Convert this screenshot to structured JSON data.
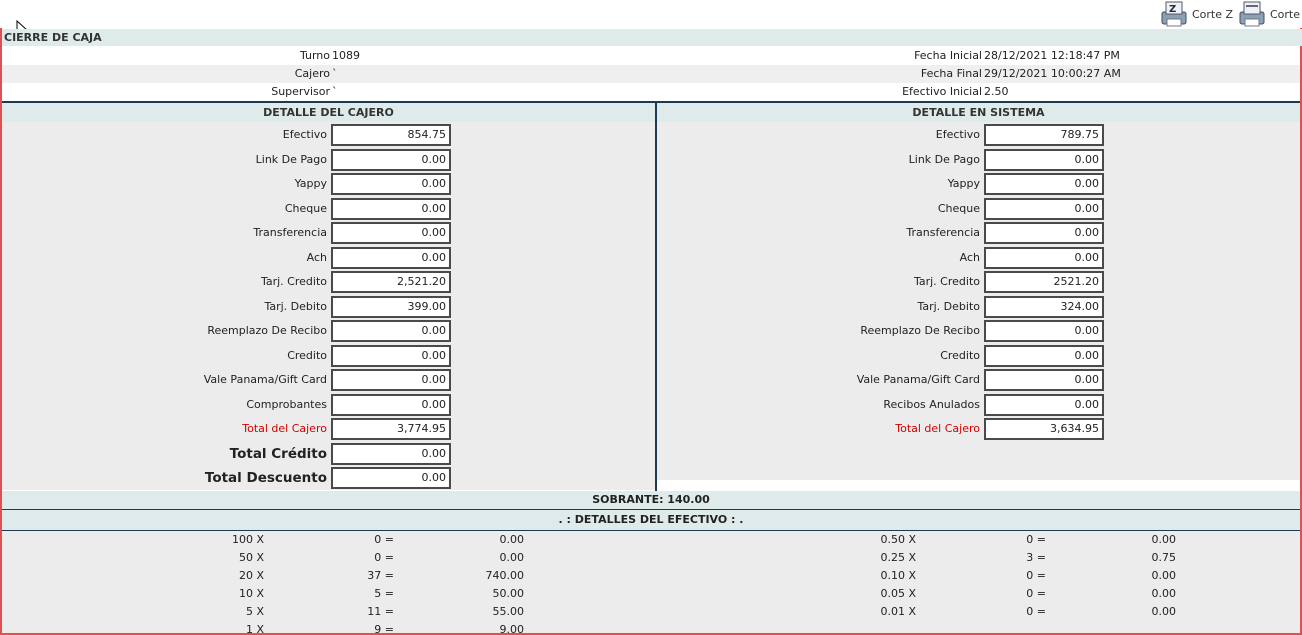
{
  "toolbar": {
    "corte_z_label": "Corte Z",
    "corte_label": "Corte"
  },
  "header": {
    "title": "CIERRE DE CAJA",
    "turno_label": "Turno",
    "turno_value": "1089",
    "cajero_label": "Cajero",
    "cajero_value": "`",
    "supervisor_label": "Supervisor",
    "supervisor_value": "`",
    "fecha_inicial_label": "Fecha Inicial",
    "fecha_inicial_value": "28/12/2021 12:18:47 PM",
    "fecha_final_label": "Fecha Final",
    "fecha_final_value": "29/12/2021 10:00:27 AM",
    "efectivo_inicial_label": "Efectivo Inicial",
    "efectivo_inicial_value": "2.50"
  },
  "cajero": {
    "title": "DETALLE DEL CAJERO",
    "rows": [
      {
        "label": "Efectivo",
        "value": "854.75"
      },
      {
        "label": "Link De Pago",
        "value": "0.00"
      },
      {
        "label": "Yappy",
        "value": "0.00"
      },
      {
        "label": "Cheque",
        "value": "0.00"
      },
      {
        "label": "Transferencia",
        "value": "0.00"
      },
      {
        "label": "Ach",
        "value": "0.00"
      },
      {
        "label": "Tarj. Credito",
        "value": "2,521.20"
      },
      {
        "label": "Tarj. Debito",
        "value": "399.00"
      },
      {
        "label": "Reemplazo De Recibo",
        "value": "0.00"
      },
      {
        "label": "Credito",
        "value": "0.00"
      },
      {
        "label": "Vale Panama/Gift Card",
        "value": "0.00"
      },
      {
        "label": "Comprobantes",
        "value": "0.00"
      },
      {
        "label": "Total del Cajero",
        "value": "3,774.95"
      },
      {
        "label": "Total Crédito",
        "value": "0.00"
      },
      {
        "label": "Total Descuento",
        "value": "0.00"
      }
    ]
  },
  "sistema": {
    "title": "DETALLE EN SISTEMA",
    "rows": [
      {
        "label": "Efectivo",
        "value": "789.75"
      },
      {
        "label": "Link De Pago",
        "value": "0.00"
      },
      {
        "label": "Yappy",
        "value": "0.00"
      },
      {
        "label": "Cheque",
        "value": "0.00"
      },
      {
        "label": "Transferencia",
        "value": "0.00"
      },
      {
        "label": "Ach",
        "value": "0.00"
      },
      {
        "label": "Tarj. Credito",
        "value": "2521.20"
      },
      {
        "label": "Tarj. Debito",
        "value": "324.00"
      },
      {
        "label": "Reemplazo De Recibo",
        "value": "0.00"
      },
      {
        "label": "Credito",
        "value": "0.00"
      },
      {
        "label": "Vale Panama/Gift Card",
        "value": "0.00"
      },
      {
        "label": "Recibos Anulados",
        "value": "0.00"
      },
      {
        "label": "Total del Cajero",
        "value": "3,634.95"
      }
    ]
  },
  "sobrante": "SOBRANTE: 140.00",
  "detalles_title": ". : DETALLES DEL EFECTIVO : .",
  "efectivo_left": [
    {
      "denom": "100 X",
      "qty": "0 =",
      "total": "0.00"
    },
    {
      "denom": "50 X",
      "qty": "0 =",
      "total": "0.00"
    },
    {
      "denom": "20 X",
      "qty": "37 =",
      "total": "740.00"
    },
    {
      "denom": "10 X",
      "qty": "5 =",
      "total": "50.00"
    },
    {
      "denom": "5 X",
      "qty": "11 =",
      "total": "55.00"
    },
    {
      "denom": "1 X",
      "qty": "9 =",
      "total": "9.00"
    }
  ],
  "efectivo_right": [
    {
      "denom": "0.50 X",
      "qty": "0 =",
      "total": "0.00"
    },
    {
      "denom": "0.25 X",
      "qty": "3 =",
      "total": "0.75"
    },
    {
      "denom": "0.10 X",
      "qty": "0 =",
      "total": "0.00"
    },
    {
      "denom": "0.05 X",
      "qty": "0 =",
      "total": "0.00"
    },
    {
      "denom": "0.01 X",
      "qty": "0 =",
      "total": "0.00"
    }
  ]
}
